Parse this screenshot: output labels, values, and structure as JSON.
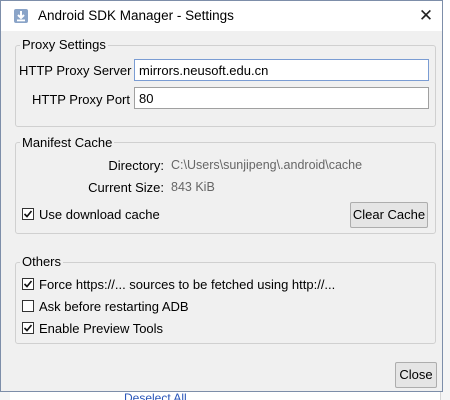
{
  "window": {
    "title": "Android SDK Manager - Settings",
    "close_glyph": "✕",
    "app_icon": "android-sdk-download-icon"
  },
  "proxy": {
    "legend": "Proxy Settings",
    "server_label": "HTTP Proxy Server",
    "server_value": "mirrors.neusoft.edu.cn",
    "port_label": "HTTP Proxy Port",
    "port_value": "80"
  },
  "manifest": {
    "legend": "Manifest Cache",
    "directory_label": "Directory:",
    "directory_value": "C:\\Users\\sunjipeng\\.android\\cache",
    "size_label": "Current Size:",
    "size_value": "843 KiB",
    "use_cache_label": "Use download cache",
    "use_cache_checked": true,
    "clear_button": "Clear Cache"
  },
  "others": {
    "legend": "Others",
    "options": [
      {
        "label": "Force https://... sources to be fetched using http://...",
        "checked": true
      },
      {
        "label": "Ask before restarting ADB",
        "checked": false
      },
      {
        "label": "Enable Preview Tools",
        "checked": true
      }
    ]
  },
  "footer": {
    "close_button": "Close"
  },
  "background": {
    "partial_link": "Deselect All"
  }
}
